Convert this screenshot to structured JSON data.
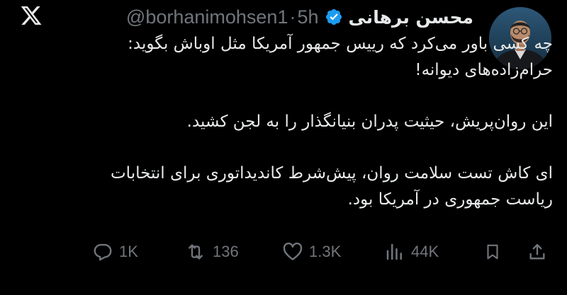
{
  "logo": {
    "icon": "x-logo-icon"
  },
  "author": {
    "display_name": "محسن برهانی",
    "handle": "@borhanimohsen1",
    "separator": "·",
    "time": "5h",
    "verified_color": "#1d9bf0"
  },
  "tweet": {
    "paragraphs": [
      "چه کسی باور می‌کرد که رییس جمهور آمریکا مثل اوباش بگوید: حرام‌زاده‌های دیوانه!",
      "این روان‌پریش، حیثیت پدران بنیانگذار را به لجن کشید.",
      "ای کاش تست سلامت روان، پیش‌شرط کاندیداتوری برای انتخابات ریاست جمهوری در آمریکا بود."
    ]
  },
  "actions": {
    "reply": {
      "icon": "reply-icon",
      "count": "1K"
    },
    "repost": {
      "icon": "repost-icon",
      "count": "136"
    },
    "like": {
      "icon": "heart-icon",
      "count": "1.3K"
    },
    "views": {
      "icon": "views-icon",
      "count": "44K"
    },
    "bookmark": {
      "icon": "bookmark-icon"
    },
    "share": {
      "icon": "share-icon"
    }
  },
  "colors": {
    "background": "#000000",
    "text": "#e7e9ea",
    "muted": "#71767b",
    "verified": "#1d9bf0"
  }
}
